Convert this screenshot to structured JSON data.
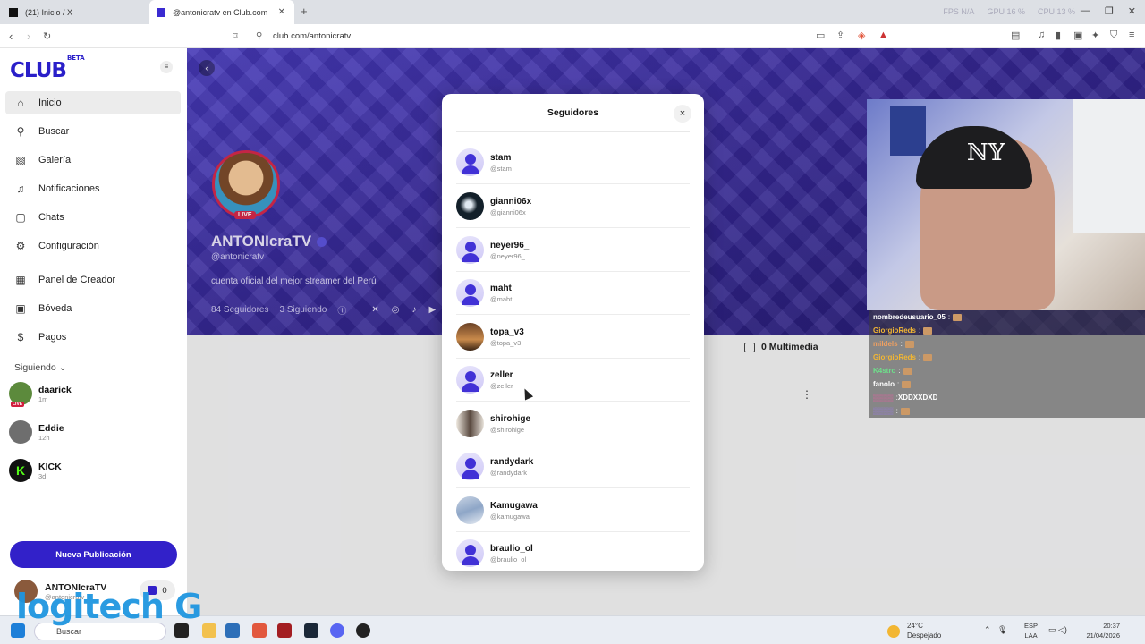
{
  "browser": {
    "tabs": [
      {
        "label": "(21) Inicio / X"
      },
      {
        "label": "@antonicratv en Club.com"
      }
    ],
    "url": "club.com/antonicratv",
    "stats": [
      "FPS N/A",
      "GPU 16 %",
      "CPU 13 %"
    ]
  },
  "sidebar": {
    "logo": "CLUB",
    "logo_sup": "BETA",
    "items": [
      {
        "label": "Inicio",
        "icon": "home-icon"
      },
      {
        "label": "Buscar",
        "icon": "search-icon"
      },
      {
        "label": "Galería",
        "icon": "gallery-icon"
      },
      {
        "label": "Notificaciones",
        "icon": "bell-icon"
      },
      {
        "label": "Chats",
        "icon": "chat-icon"
      },
      {
        "label": "Configuración",
        "icon": "gear-icon"
      },
      {
        "label": "Panel de Creador",
        "icon": "grid-icon"
      },
      {
        "label": "Bóveda",
        "icon": "vault-icon"
      },
      {
        "label": "Pagos",
        "icon": "dollar-icon"
      }
    ],
    "following_label": "Siguiendo",
    "following": [
      {
        "name": "daarick",
        "time": "1m",
        "live": "LIVE"
      },
      {
        "name": "Eddie",
        "time": "12h"
      },
      {
        "name": "KICK",
        "time": "3d"
      }
    ],
    "publish": "Nueva Publicación",
    "me": {
      "name": "ANTONIcraTV",
      "handle": "@antonicratv",
      "coins": "0"
    }
  },
  "profile": {
    "live": "LIVE",
    "name": "ANTONIcraTV",
    "handle": "@antonicratv",
    "bio": "cuenta oficial del mejor streamer del Perú",
    "followers": "84 Seguidores",
    "following": "3 Siguiendo",
    "multimedia": "0 Multimedia"
  },
  "modal": {
    "title": "Seguidores",
    "close": "×",
    "followers": [
      {
        "name": "stam",
        "handle": "@stam"
      },
      {
        "name": "gianni06x",
        "handle": "@gianni06x"
      },
      {
        "name": "neyer96_",
        "handle": "@neyer96_"
      },
      {
        "name": "maht",
        "handle": "@maht"
      },
      {
        "name": "topa_v3",
        "handle": "@topa_v3"
      },
      {
        "name": "zeller",
        "handle": "@zeller"
      },
      {
        "name": "shirohige",
        "handle": "@shirohige"
      },
      {
        "name": "randydark",
        "handle": "@randydark"
      },
      {
        "name": "Kamugawa",
        "handle": "@kamugawa"
      },
      {
        "name": "braulio_ol",
        "handle": "@braulio_ol"
      }
    ]
  },
  "stream_chat": [
    {
      "user": "nombredeusuario_05",
      "msg": "",
      "color": "#ffffff"
    },
    {
      "user": "GiorgioReds",
      "msg": "",
      "color": "#f2b632"
    },
    {
      "user": "mildels",
      "msg": "",
      "color": "#f0a060"
    },
    {
      "user": "GiorgioReds",
      "msg": "",
      "color": "#f2b632"
    },
    {
      "user": "K4stro",
      "msg": "",
      "color": "#6de08a"
    },
    {
      "user": "fanolo",
      "msg": "",
      "color": "#ffffff"
    },
    {
      "user": "",
      "msg": "XDDXXDXD",
      "color": "#e060a0"
    },
    {
      "user": "",
      "msg": "",
      "color": "#9a7ae0"
    }
  ],
  "taskbar": {
    "search": "Buscar",
    "weather_temp": "24°C",
    "weather_desc": "Despejado",
    "lang1": "ESP",
    "lang2": "LAA",
    "time": "20:37",
    "date": "21/04/2026"
  },
  "overlay": {
    "logitech": "logitech G"
  }
}
